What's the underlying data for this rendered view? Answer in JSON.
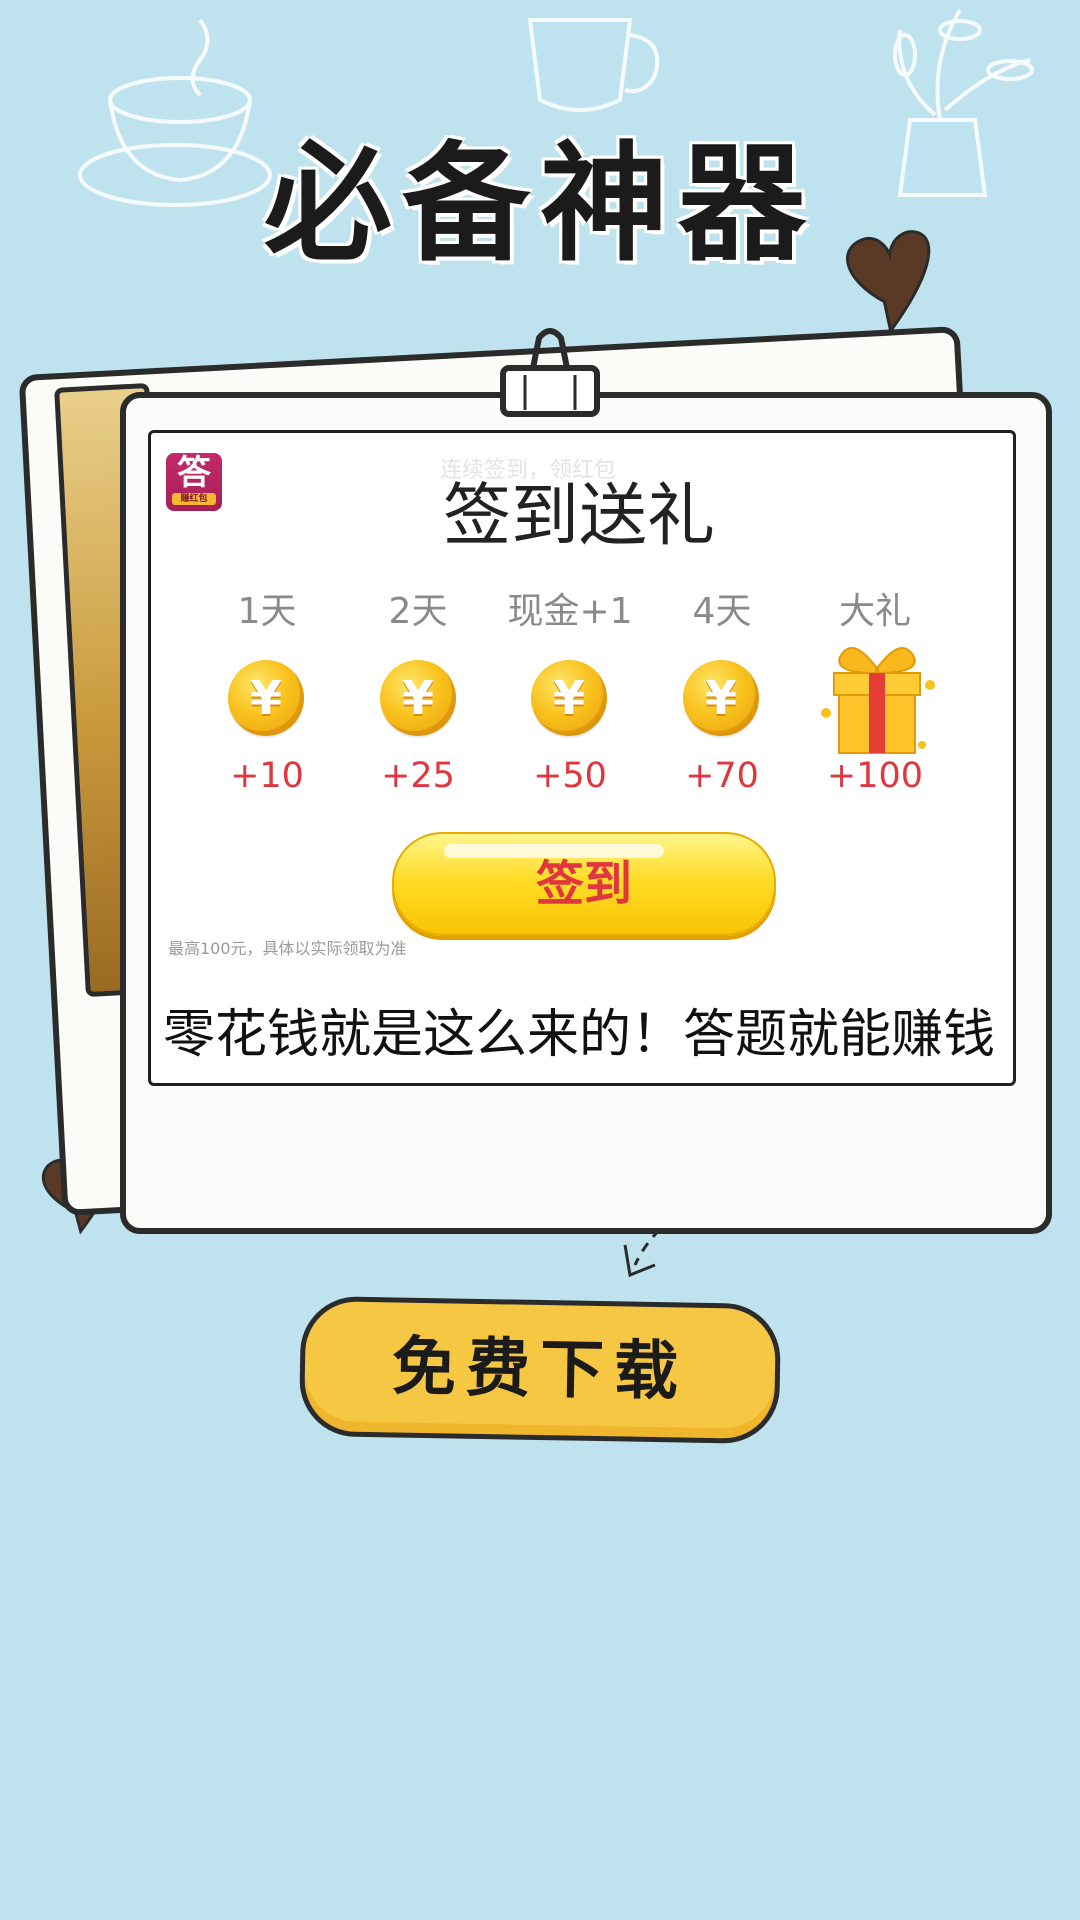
{
  "headline": "必备神器",
  "card": {
    "title": "签到送礼",
    "ghost_subtitle": "连续签到，领红包",
    "logo": {
      "glyph": "答",
      "badge": "赚红包"
    },
    "days": [
      {
        "label": "1天",
        "reward": "+10",
        "icon": "coin-icon",
        "symbol": "¥"
      },
      {
        "label": "2天",
        "reward": "+25",
        "icon": "coin-icon",
        "symbol": "¥"
      },
      {
        "label": "现金+1",
        "reward": "+50",
        "icon": "coin-icon",
        "symbol": "¥"
      },
      {
        "label": "4天",
        "reward": "+70",
        "icon": "coin-icon",
        "symbol": "¥"
      },
      {
        "label": "大礼",
        "reward": "+100",
        "icon": "gift-icon"
      }
    ],
    "signin_button": "签到",
    "note": "最高100元，具体以实际领取为准",
    "tagline": "零花钱就是这么来的！答题就能赚钱"
  },
  "download_button": "免费下载",
  "colors": {
    "background": "#bfe3ee",
    "reward_red": "#e0363f",
    "button_yellow": "#ffdd27",
    "download_yellow": "#f6c743"
  }
}
